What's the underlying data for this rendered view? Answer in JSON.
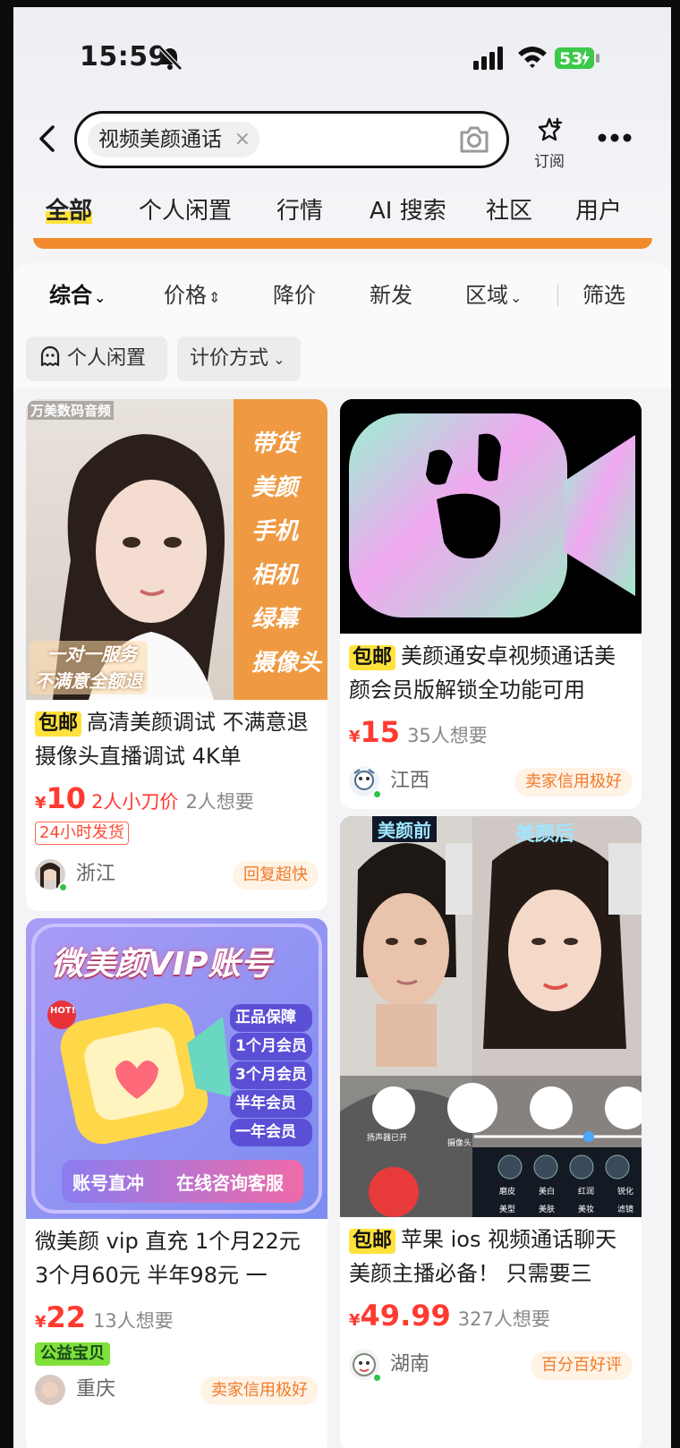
{
  "status_bar": {
    "time": "15:59",
    "battery": "53"
  },
  "search": {
    "query": "视频美颜通话",
    "clear": "×"
  },
  "header": {
    "subscribe_label": "订阅"
  },
  "category_tabs": [
    "全部",
    "个人闲置",
    "行情",
    "AI 搜索",
    "社区",
    "用户"
  ],
  "sort_bar": {
    "items": [
      "综合",
      "价格",
      "降价",
      "新发",
      "区域",
      "筛选"
    ]
  },
  "filters": [
    "个人闲置",
    "计价方式"
  ],
  "cards": [
    {
      "image_labels": [
        "带货",
        "美颜",
        "手机",
        "相机",
        "绿幕",
        "摄像头"
      ],
      "image_corner": "万美数码音频",
      "image_slogan_1": "一对一服务",
      "image_slogan_2": "不满意全额退",
      "free_shipping": "包邮",
      "title": "高清美颜调试 不满意退 摄像头直播调试 4K单",
      "yen": "¥",
      "price": "10",
      "cut": "2人小刀价",
      "want": "2人想要",
      "tag": "24小时发货",
      "region": "浙江",
      "seller_tag": "回复超快"
    },
    {
      "free_shipping": "包邮",
      "title": "美颜通安卓视频通话美颜会员版解锁全功能可用",
      "yen": "¥",
      "price": "15",
      "want": "35人想要",
      "region": "江西",
      "seller_tag": "卖家信用极好"
    },
    {
      "image_title": "微美颜VIP账号",
      "image_hot": "HOT!",
      "image_list": [
        "正品保障",
        "1个月会员",
        "3个月会员",
        "半年会员",
        "一年会员"
      ],
      "image_left_btn": "账号直冲",
      "image_right_btn": "在线咨询客服",
      "title": "微美颜 vip 直充 1个月22元 3个月60元 半年98元 一",
      "yen": "¥",
      "price": "22",
      "want": "13人想要",
      "tag": "公益宝贝",
      "region": "重庆",
      "seller_tag": "卖家信用极好"
    },
    {
      "image_before": "美颜前",
      "image_after": "美颜后",
      "image_controls": [
        "扬声器已开",
        "摄像头"
      ],
      "image_beauty_items": [
        "磨皮",
        "美白",
        "红润",
        "锐化"
      ],
      "image_beauty_tabs": [
        "美型",
        "美肤",
        "美妆",
        "滤镜"
      ],
      "free_shipping": "包邮",
      "title": "苹果 ios 视频通话聊天美颜主播必备！ 只需要三",
      "yen": "¥",
      "price": "49.99",
      "want": "327人想要",
      "region": "湖南",
      "seller_tag": "百分百好评"
    }
  ],
  "colors": {
    "accent": "#ffe23b",
    "price": "#ff3a30",
    "orange": "#f08a2c"
  }
}
